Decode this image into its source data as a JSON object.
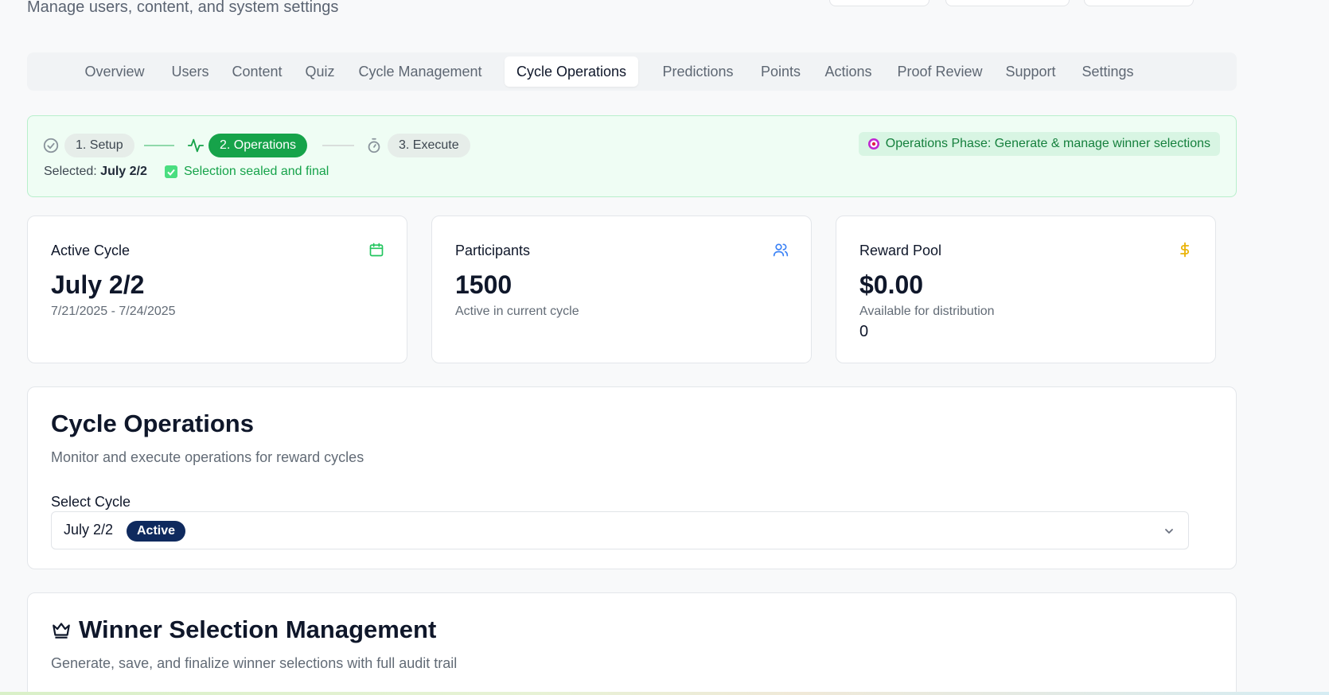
{
  "header": {
    "subtitle": "Manage users, content, and system settings"
  },
  "tabs": [
    {
      "label": "Overview"
    },
    {
      "label": "Users"
    },
    {
      "label": "Content"
    },
    {
      "label": "Quiz"
    },
    {
      "label": "Cycle Management"
    },
    {
      "label": "Cycle Operations",
      "active": true
    },
    {
      "label": "Predictions"
    },
    {
      "label": "Points"
    },
    {
      "label": "Actions"
    },
    {
      "label": "Proof Review"
    },
    {
      "label": "Support"
    },
    {
      "label": "Settings"
    }
  ],
  "phase": {
    "steps": [
      {
        "label": "1. Setup",
        "icon": "check-circle-icon"
      },
      {
        "label": "2. Operations",
        "icon": "activity-icon",
        "active": true
      },
      {
        "label": "3. Execute",
        "icon": "timer-icon"
      }
    ],
    "selected_prefix": "Selected:",
    "selected_value": "July 2/2",
    "sealed_text": "Selection sealed and final",
    "badge_text": "Operations Phase: Generate & manage winner selections",
    "badge_icon": "target-icon"
  },
  "stats": {
    "active_cycle": {
      "title": "Active Cycle",
      "value": "July 2/2",
      "sub": "7/21/2025 - 7/24/2025",
      "icon": "calendar-icon"
    },
    "participants": {
      "title": "Participants",
      "value": "1500",
      "sub": "Active in current cycle",
      "icon": "users-icon"
    },
    "reward_pool": {
      "title": "Reward Pool",
      "value": "$0.00",
      "sub": "Available for distribution",
      "extra": "0",
      "icon": "dollar-icon"
    }
  },
  "cycle_operations": {
    "title": "Cycle Operations",
    "description": "Monitor and execute operations for reward cycles",
    "select_label": "Select Cycle",
    "select_value": "July 2/2",
    "select_badge": "Active"
  },
  "winner_selection": {
    "title": "Winner Selection Management",
    "description": "Generate, save, and finalize winner selections with full audit trail",
    "icon": "crown-icon"
  },
  "colors": {
    "primary_green": "#16a34a",
    "phase_bg": "#effdf4",
    "badge_navy": "#0f2a5e",
    "users_icon": "#3b82f6",
    "dollar_icon": "#eab308"
  }
}
